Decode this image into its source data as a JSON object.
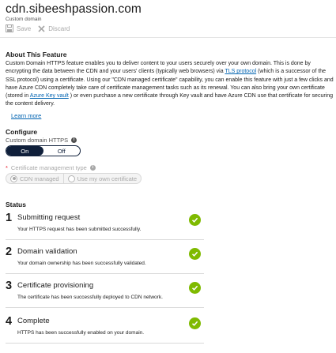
{
  "header": {
    "title": "cdn.sibeeshpassion.com",
    "subtitle": "Custom domain"
  },
  "toolbar": {
    "save_label": "Save",
    "discard_label": "Discard",
    "save_icon": "save-icon",
    "discard_icon": "close-icon"
  },
  "about": {
    "title": "About This Feature",
    "text_part1": "Custom Domain HTTPS feature enables you to deliver content to your users securely over your own domain. This is done by encrypting the data between the CDN and your users' clients (typically web browsers) via ",
    "tls_link": "TLS protocol",
    "text_part2": " (which is a successor of the SSL protocol) using a certificate. Using our \"CDN managed certificate\" capability, you can enable this feature with just a few clicks and have Azure CDN completely take care of certificate management tasks such as its renewal. You can also bring your own certificate (stored in ",
    "keyvault_link": "Azure Key vault",
    "text_part3": " ) or even purchase a new certificate through Key vault and have Azure CDN use that certificate for securing the content delivery.",
    "learn_more": "Learn more"
  },
  "configure": {
    "title": "Configure",
    "https_label": "Custom domain HTTPS",
    "https_options": [
      "On",
      "Off"
    ],
    "https_selected": "On",
    "required_mark": "*",
    "cert_label": "Certificate management type",
    "cert_options": [
      "CDN managed",
      "Use my own certificate"
    ],
    "cert_selected": "CDN managed"
  },
  "status": {
    "title": "Status",
    "steps": [
      {
        "num": "1",
        "title": "Submitting request",
        "desc": "Your HTTPS request has been submitted successfully.",
        "state": "complete"
      },
      {
        "num": "2",
        "title": "Domain validation",
        "desc": "Your domain ownership has been successfully validated.",
        "state": "complete"
      },
      {
        "num": "3",
        "title": "Certificate provisioning",
        "desc": "The certificate has been successfully deployed to CDN network.",
        "state": "complete"
      },
      {
        "num": "4",
        "title": "Complete",
        "desc": "HTTPS has been successfully enabled on your domain.",
        "state": "complete"
      }
    ]
  },
  "colors": {
    "accent": "#0f1f3a",
    "link": "#0063b1",
    "success": "#7fba00",
    "required": "#e81123"
  }
}
